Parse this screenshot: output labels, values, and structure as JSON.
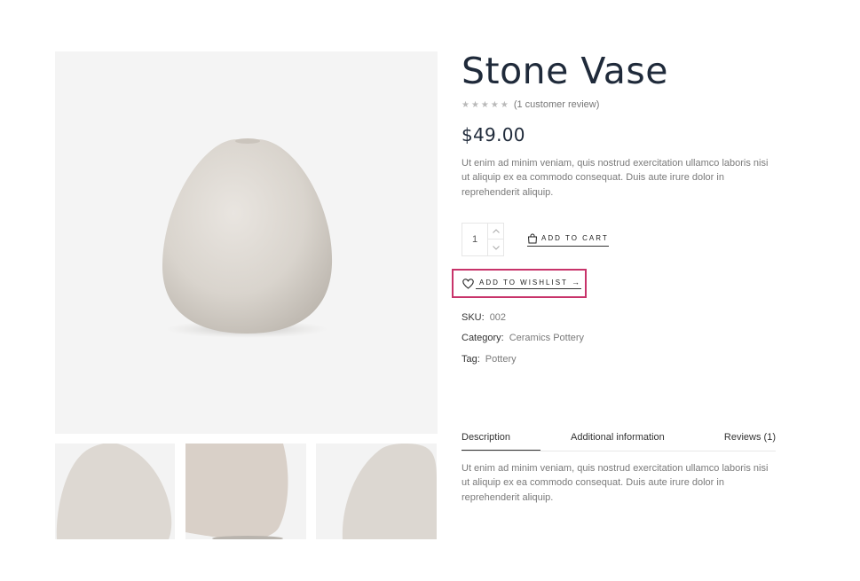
{
  "product": {
    "title": "Stone Vase",
    "stars": "★★★★★",
    "review_text": "(1 customer review)",
    "price": "$49.00",
    "short_description": "Ut enim ad minim veniam, quis nostrud exercitation ullamco laboris nisi ut aliquip ex ea commodo consequat. Duis aute irure dolor in reprehenderit aliquip."
  },
  "cart": {
    "quantity": "1",
    "add_to_cart_label": "ADD TO CART",
    "add_to_wishlist_label": "ADD TO WISHLIST",
    "wishlist_arrow": "→"
  },
  "meta": {
    "sku_label": "SKU:",
    "sku_value": "002",
    "category_label": "Category:",
    "category_value": "Ceramics Pottery",
    "tag_label": "Tag:",
    "tag_value": "Pottery"
  },
  "tabs": {
    "items": [
      {
        "label": "Description"
      },
      {
        "label": "Additional information"
      },
      {
        "label": "Reviews (1)"
      }
    ],
    "active": "Description",
    "content": "Ut enim ad minim veniam, quis nostrud exercitation ullamco laboris nisi ut aliquip ex ea commodo consequat. Duis aute irure dolor in reprehenderit aliquip."
  },
  "colors": {
    "highlight_border": "#c8336a",
    "title": "#1f2a3a",
    "body_text": "#7a7a7a"
  },
  "icons": [
    "bag-icon",
    "heart-icon",
    "chevron-up-icon",
    "chevron-down-icon",
    "arrow-right-icon"
  ]
}
